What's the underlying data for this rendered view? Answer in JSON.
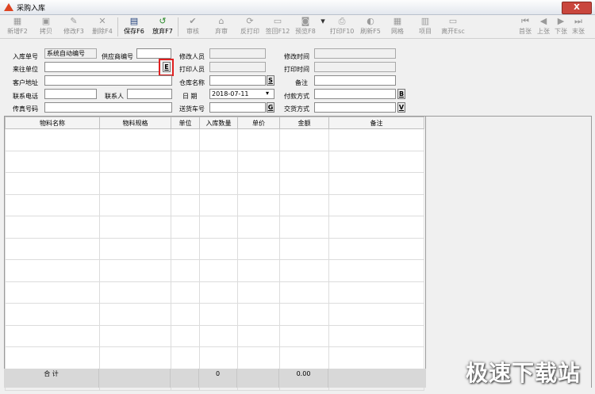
{
  "window": {
    "title": "采购入库",
    "close_label": "X"
  },
  "toolbar": {
    "items": [
      {
        "label": "新增F2",
        "icon": "new-icon",
        "enabled": false
      },
      {
        "label": "拷贝",
        "icon": "copy-icon",
        "enabled": false
      },
      {
        "label": "修改F3",
        "icon": "edit-icon",
        "enabled": false
      },
      {
        "label": "删除F4",
        "icon": "delete-icon",
        "enabled": false
      },
      {
        "label": "保存F6",
        "icon": "save-icon",
        "enabled": true
      },
      {
        "label": "放弃F7",
        "icon": "undo-icon",
        "enabled": true
      },
      {
        "label": "审核",
        "icon": "check-icon",
        "enabled": false
      },
      {
        "label": "弃审",
        "icon": "unapprove-icon",
        "enabled": false
      },
      {
        "label": "反打印",
        "icon": "refresh-icon",
        "enabled": false
      },
      {
        "label": "签回F12",
        "icon": "sign-icon",
        "enabled": false
      },
      {
        "label": "预览F8",
        "icon": "preview-icon",
        "enabled": false
      },
      {
        "label": "打印F10",
        "icon": "print-icon",
        "enabled": false
      },
      {
        "label": "刷新F5",
        "icon": "reload-icon",
        "enabled": false
      },
      {
        "label": "网格",
        "icon": "grid-icon",
        "enabled": false
      },
      {
        "label": "项目",
        "icon": "project-icon",
        "enabled": false
      },
      {
        "label": "离开Esc",
        "icon": "exit-icon",
        "enabled": false
      }
    ],
    "nav": [
      {
        "label": "首张",
        "icon": "first-icon"
      },
      {
        "label": "上张",
        "icon": "prev-icon"
      },
      {
        "label": "下张",
        "icon": "next-icon"
      },
      {
        "label": "末张",
        "icon": "last-icon"
      }
    ]
  },
  "form": {
    "order_no_label": "入库单号",
    "order_no_value": "系统自动编号",
    "supplier_code_label": "供应商编号",
    "supplier_label": "来往单位",
    "customer_addr_label": "客户地址",
    "phone_label": "联系电话",
    "contact_label": "联系人",
    "fax_label": "传真号码",
    "modifier_label": "修改人员",
    "printer_label": "打印人员",
    "warehouse_label": "仓库名称",
    "date_label": "日  期",
    "date_value": "2018-07-11",
    "delivery_label": "送货车号",
    "modify_time_label": "修改时间",
    "print_time_label": "打印时间",
    "remark_label": "备注",
    "payment_label": "付款方式",
    "trade_label": "交货方式",
    "btn_e": "E",
    "btn_s": "S",
    "btn_g": "G",
    "btn_b": "B",
    "btn_v": "V"
  },
  "grid": {
    "columns": [
      "物料名称",
      "物料规格",
      "单位",
      "入库数量",
      "单价",
      "金额",
      "备注"
    ],
    "total_label": "合 计",
    "total_qty": "0",
    "total_amount": "0.00"
  },
  "watermark": "极速下载站"
}
